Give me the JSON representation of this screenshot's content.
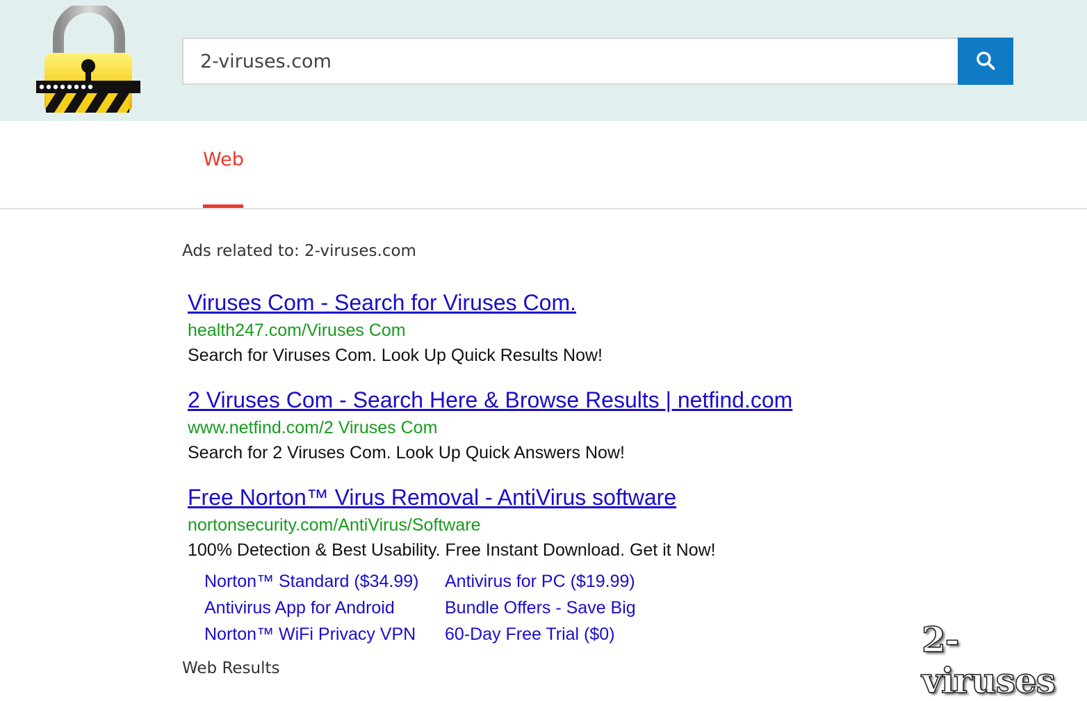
{
  "header": {
    "logo_icon": "padlock-logo-icon",
    "search": {
      "value": "2-viruses.com",
      "button_icon": "search-icon"
    }
  },
  "tabs": [
    {
      "label": "Web",
      "active": true
    }
  ],
  "ads": {
    "heading": "Ads related to: 2-viruses.com",
    "items": [
      {
        "title": "Viruses Com - Search for Viruses Com.",
        "url": "health247.com/Viruses Com",
        "description": "Search for Viruses Com. Look Up Quick Results Now!"
      },
      {
        "title": "2 Viruses Com - Search Here & Browse Results | netfind.com",
        "url": "www.netfind.com/2 Viruses Com",
        "description": "Search for 2 Viruses Com. Look Up Quick Answers Now!"
      },
      {
        "title": "Free Norton™ Virus Removal - AntiVirus software",
        "url": "nortonsecurity.com/AntiVirus/Software",
        "description": "100% Detection & Best Usability. Free Instant Download. Get it Now!",
        "sitelinks": [
          "Norton™ Standard ($34.99)",
          "Antivirus for PC ($19.99)",
          "Antivirus App for Android",
          "Bundle Offers - Save Big",
          "Norton™ WiFi Privacy VPN",
          "60-Day Free Trial ($0)"
        ]
      }
    ]
  },
  "next_section_heading": "Web Results",
  "watermark": "2-viruses",
  "colors": {
    "header_bg": "#e2efef",
    "search_button": "#0f7bc4",
    "active_tab": "#e8392d",
    "ad_title": "#1a0dcc",
    "ad_url": "#169c1c"
  }
}
